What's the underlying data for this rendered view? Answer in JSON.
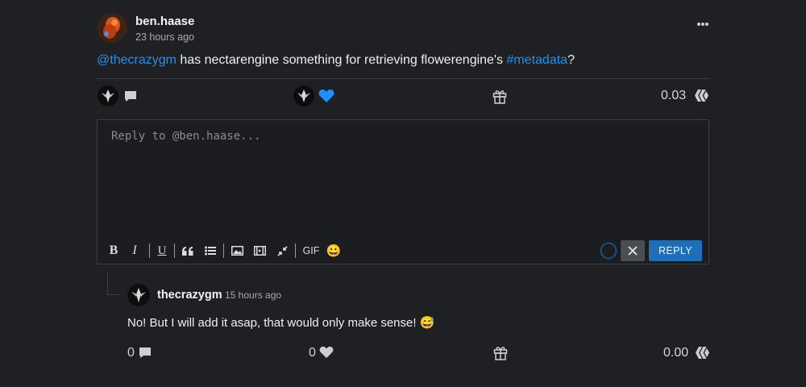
{
  "post": {
    "author": "ben.haase",
    "time": "23 hours ago",
    "mention": "@thecrazygm",
    "text_middle": " has nectarengine something for retrieving flowerengine's ",
    "hashtag": "#metadata",
    "text_end": "?",
    "payout": "0.03",
    "menu_icon": "more-dots-icon"
  },
  "editor": {
    "placeholder": "Reply to @ben.haase...",
    "toolbar": {
      "bold": "B",
      "italic": "I",
      "underline": "U",
      "gif": "GIF",
      "emoji": "😀"
    },
    "reply_label": "REPLY"
  },
  "reply": {
    "author": "thecrazygm",
    "time": "15 hours ago",
    "text": "No! But I will add it asap, that would only make sense! 😅",
    "comment_count": "0",
    "like_count": "0",
    "payout": "0.00"
  },
  "colors": {
    "background": "#1e2023",
    "link": "#2b8fe6",
    "heart": "#1e90ff",
    "reply_button": "#1f6fb8"
  }
}
